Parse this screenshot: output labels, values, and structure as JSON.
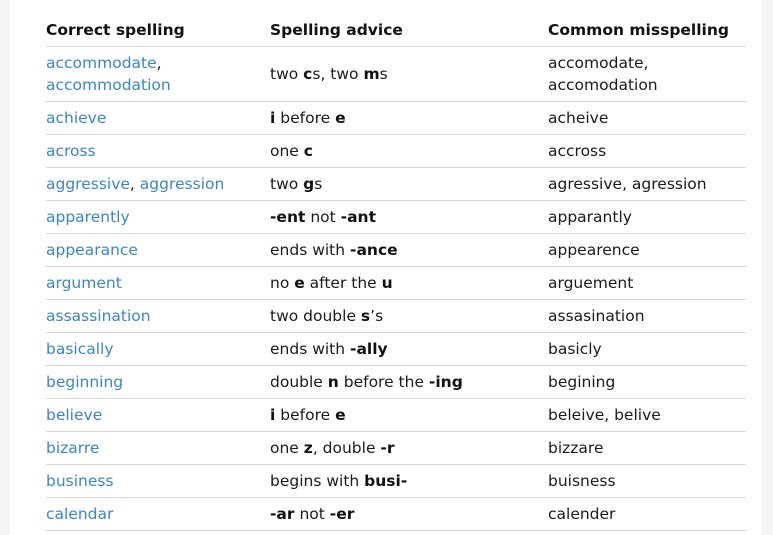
{
  "table": {
    "headers": {
      "correct": "Correct spelling",
      "advice": "Spelling advice",
      "misspelling": "Common misspelling"
    },
    "rows": [
      {
        "correct": [
          "accommodate",
          "accommodation"
        ],
        "correct_sep": ",",
        "advice": [
          [
            "two ",
            ""
          ],
          [
            "c",
            "b"
          ],
          [
            "s, two ",
            ""
          ],
          [
            "m",
            "b"
          ],
          [
            "s",
            ""
          ]
        ],
        "misspelling": "accomodate, accomodation"
      },
      {
        "correct": [
          "achieve"
        ],
        "advice": [
          [
            "i",
            "b"
          ],
          [
            " before ",
            ""
          ],
          [
            "e",
            "b"
          ]
        ],
        "misspelling": "acheive"
      },
      {
        "correct": [
          "across"
        ],
        "advice": [
          [
            "one ",
            ""
          ],
          [
            "c",
            "b"
          ]
        ],
        "misspelling": "accross"
      },
      {
        "correct": [
          "aggressive",
          "aggression"
        ],
        "correct_sep": ",",
        "advice": [
          [
            "two ",
            ""
          ],
          [
            "g",
            "b"
          ],
          [
            "s",
            ""
          ]
        ],
        "misspelling": "agressive, agression"
      },
      {
        "correct": [
          "apparently"
        ],
        "advice": [
          [
            "-ent",
            "b"
          ],
          [
            " not ",
            ""
          ],
          [
            "-ant",
            "b"
          ]
        ],
        "misspelling": "apparantly"
      },
      {
        "correct": [
          "appearance"
        ],
        "advice": [
          [
            "ends with ",
            ""
          ],
          [
            "-ance",
            "b"
          ]
        ],
        "misspelling": "appearence"
      },
      {
        "correct": [
          "argument"
        ],
        "advice": [
          [
            "no ",
            ""
          ],
          [
            "e",
            "b"
          ],
          [
            " after the ",
            ""
          ],
          [
            "u",
            "b"
          ]
        ],
        "misspelling": "arguement"
      },
      {
        "correct": [
          "assassination"
        ],
        "advice": [
          [
            "two double ",
            ""
          ],
          [
            "s",
            "b"
          ],
          [
            "’s",
            ""
          ]
        ],
        "misspelling": "assasination"
      },
      {
        "correct": [
          "basically"
        ],
        "advice": [
          [
            "ends with ",
            ""
          ],
          [
            "-ally",
            "b"
          ]
        ],
        "misspelling": "basicly"
      },
      {
        "correct": [
          "beginning"
        ],
        "advice": [
          [
            "double ",
            ""
          ],
          [
            "n",
            "b"
          ],
          [
            " before the ",
            ""
          ],
          [
            "-ing",
            "b"
          ]
        ],
        "misspelling": "begining"
      },
      {
        "correct": [
          "believe"
        ],
        "advice": [
          [
            "i",
            "b"
          ],
          [
            " before ",
            ""
          ],
          [
            "e",
            "b"
          ]
        ],
        "misspelling": "beleive, belive"
      },
      {
        "correct": [
          "bizarre"
        ],
        "advice": [
          [
            "one ",
            ""
          ],
          [
            "z",
            "b"
          ],
          [
            ", double ",
            ""
          ],
          [
            "-r",
            "b"
          ]
        ],
        "misspelling": "bizzare"
      },
      {
        "correct": [
          "business"
        ],
        "advice": [
          [
            "begins with ",
            ""
          ],
          [
            "busi-",
            "b"
          ]
        ],
        "misspelling": "buisness"
      },
      {
        "correct": [
          "calendar"
        ],
        "advice": [
          [
            "-ar",
            "b"
          ],
          [
            " not ",
            ""
          ],
          [
            "-er",
            "b"
          ]
        ],
        "misspelling": "calender"
      }
    ]
  },
  "colors": {
    "link": "#3c86c4",
    "text": "#1a1a1a",
    "rule": "#d6d6d6"
  }
}
